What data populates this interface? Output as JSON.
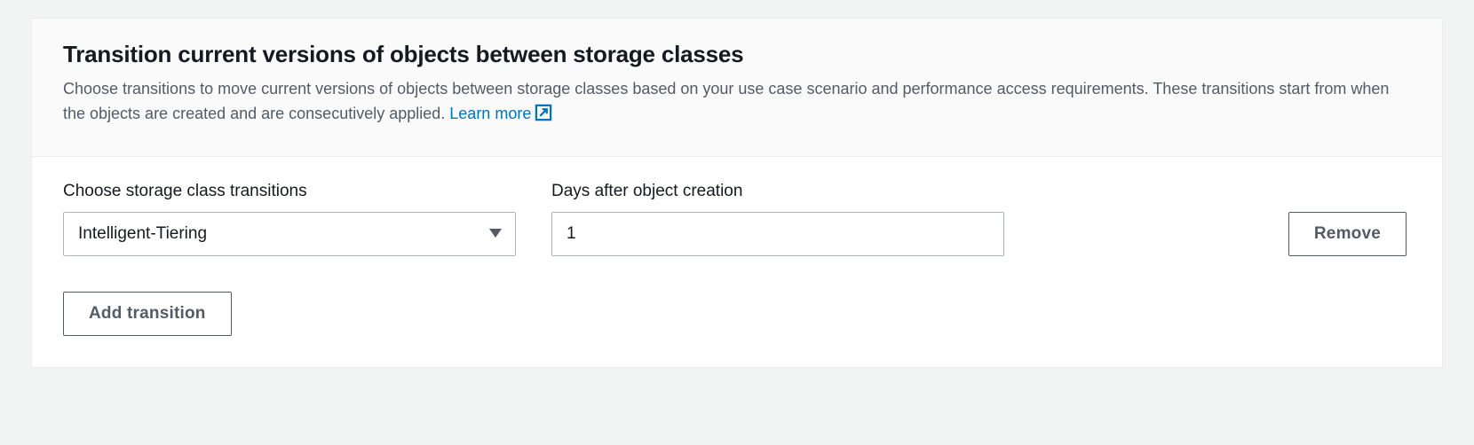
{
  "header": {
    "title": "Transition current versions of objects between storage classes",
    "description_pre": "Choose transitions to move current versions of objects between storage classes based on your use case scenario and performance access requirements. These transitions start from when the objects are created and are consecutively applied. ",
    "learn_more": "Learn more"
  },
  "form": {
    "storage_class_label": "Choose storage class transitions",
    "days_label": "Days after object creation",
    "remove_label": "Remove",
    "add_label": "Add transition",
    "transitions": [
      {
        "storage_class": "Intelligent-Tiering",
        "days": "1"
      }
    ]
  }
}
